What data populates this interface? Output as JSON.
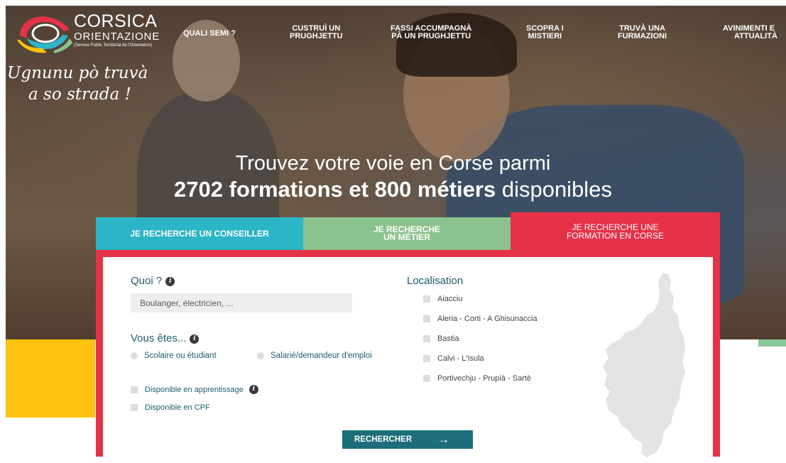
{
  "logo": {
    "line1": "CORSICA",
    "line2": "ORIENTAZIONE",
    "line3": "(Service Public Territorial de l'Orientation)"
  },
  "tagline": {
    "line1": "Ugnunu pò truvà",
    "line2": "a so strada !"
  },
  "nav": {
    "items": [
      {
        "label": "QUALI SEMI ?"
      },
      {
        "label1": "CUSTRUÌ UN",
        "label2": "PRUGHJETTU"
      },
      {
        "label1": "FASSI ACCUMPAGNÀ",
        "label2": "PÀ UN PRUGHJETTU"
      },
      {
        "label1": "SCOPRA I",
        "label2": "MISTIERI"
      },
      {
        "label1": "TRUVÀ UNA",
        "label2": "FURMAZIONI"
      },
      {
        "label1": "AVINIMENTI È",
        "label2": "ATTUALITÀ"
      }
    ]
  },
  "headline": {
    "line1": "Trouvez votre voie en Corse parmi",
    "bold": "2702 formations et 800 métiers",
    "rest": " disponibles"
  },
  "tabs": [
    {
      "label1": "JE RECHERCHE UN CONSEILLER"
    },
    {
      "label1": "JE RECHERCHE",
      "label2": "UN MÉTIER"
    },
    {
      "label1": "JE RECHERCHE UNE",
      "label2": "FORMATION EN CORSE"
    }
  ],
  "form": {
    "quoi_label": "Quoi ?",
    "info_glyph": "i",
    "search_placeholder": "Boulanger, électricien, ...",
    "vous_label": "Vous êtes...",
    "radios": [
      "Scolaire ou étudiant",
      "Salarié/demandeur d'emploi"
    ],
    "checks": [
      "Disponible en apprentissage",
      "Disponible en CPF"
    ],
    "localisation_label": "Localisation",
    "locations": [
      "Aiacciu",
      "Aleria - Corti - A Ghisunaccia",
      "Bastia",
      "Calvi - L'Isula",
      "Portivechju - Prupià - Sartè"
    ],
    "button_label": "RECHERCHER",
    "button_arrow": "→"
  },
  "colors": {
    "accent_red": "#e53248",
    "accent_teal": "#2cb4c7",
    "accent_green": "#8cc28e",
    "accent_yellow": "#ffc20e",
    "text_teal": "#1e5b6e",
    "button": "#1e6d7a"
  }
}
